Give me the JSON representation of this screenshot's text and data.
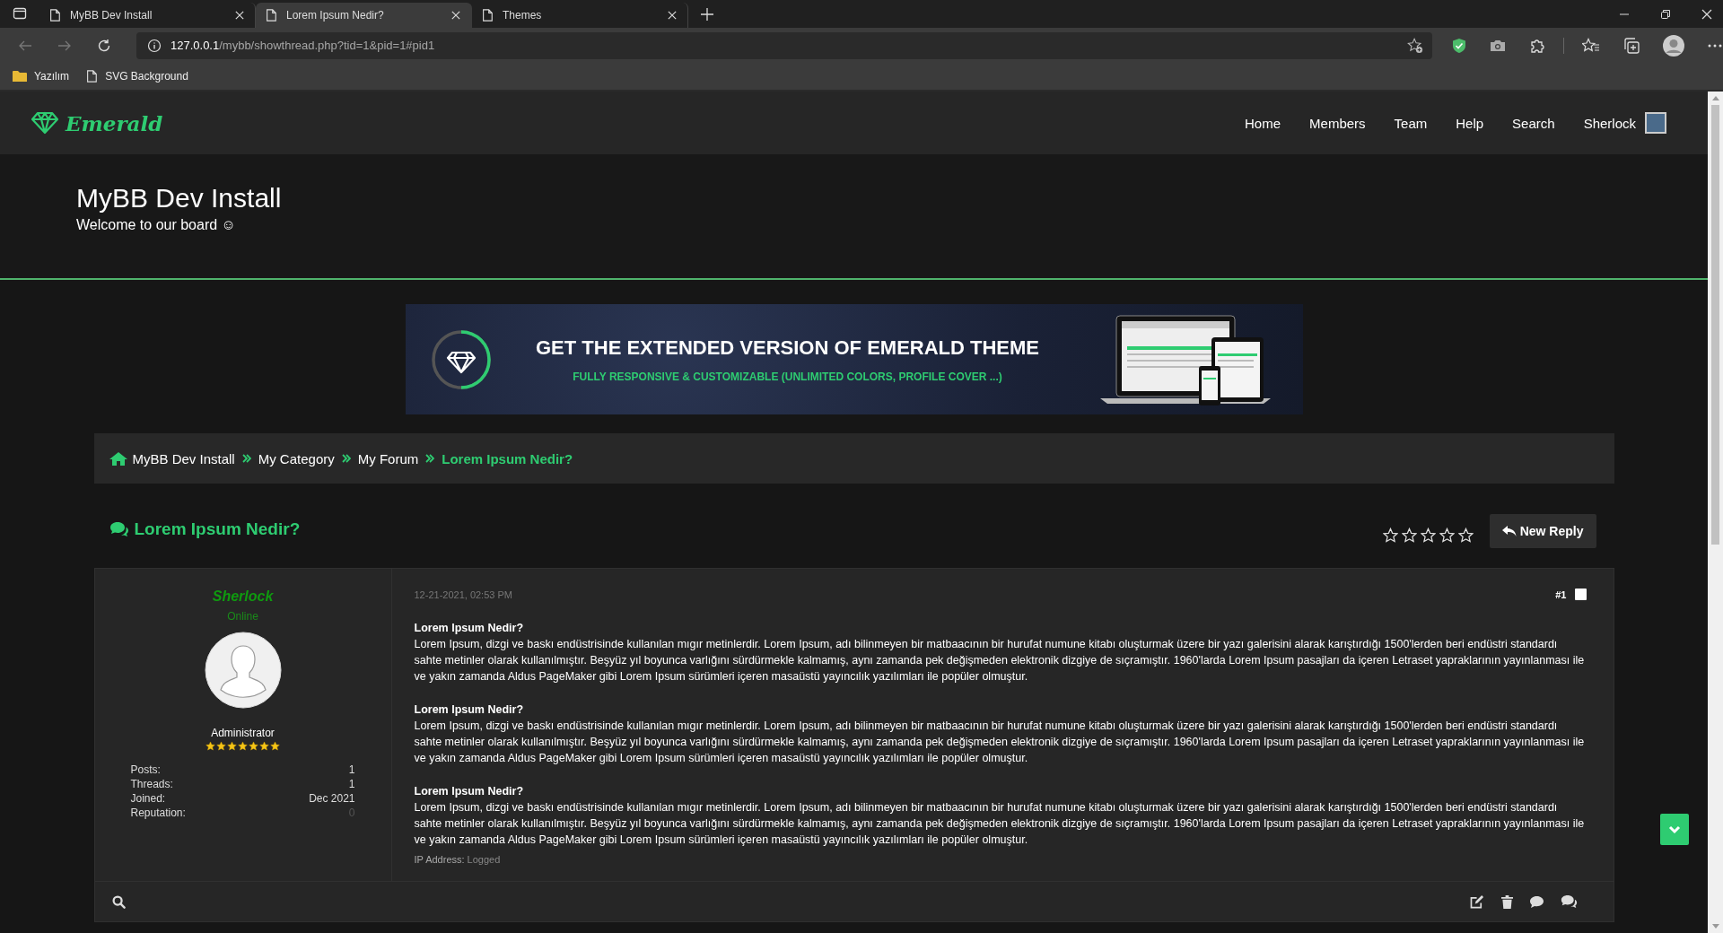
{
  "browser": {
    "tabs": [
      {
        "title": "MyBB Dev Install",
        "selected": false
      },
      {
        "title": "Lorem Ipsum Nedir?",
        "selected": true
      },
      {
        "title": "Themes",
        "selected": false
      }
    ],
    "address": {
      "host": "127.0.0.1",
      "path": "/mybb/showthread.php?tid=1&pid=1#pid1"
    },
    "bookmarks": [
      {
        "kind": "folder",
        "label": "Yazılım"
      },
      {
        "kind": "page",
        "label": "SVG Background"
      }
    ]
  },
  "site": {
    "logo": "Emerald",
    "nav": [
      "Home",
      "Members",
      "Team",
      "Help",
      "Search"
    ],
    "user": "Sherlock",
    "board_title": "MyBB Dev Install",
    "board_subtitle": "Welcome to our board ☺"
  },
  "banner": {
    "headline": "GET THE EXTENDED VERSION OF EMERALD THEME",
    "tagline": "FULLY RESPONSIVE & CUSTOMIZABLE (UNLIMITED COLORS, PROFILE COVER ...)"
  },
  "breadcrumb": [
    {
      "label": "MyBB Dev Install",
      "current": false
    },
    {
      "label": "My Category",
      "current": false
    },
    {
      "label": "My Forum",
      "current": false
    },
    {
      "label": "Lorem Ipsum Nedir?",
      "current": true
    }
  ],
  "thread": {
    "title": "Lorem Ipsum Nedir?",
    "rating": {
      "stars": 0
    },
    "new_reply": "New Reply"
  },
  "post": {
    "author": "Sherlock",
    "status": "Online",
    "role": "Administrator",
    "stars": 7,
    "stats": [
      {
        "label": "Posts:",
        "value": "1",
        "dim": false
      },
      {
        "label": "Threads:",
        "value": "1",
        "dim": false
      },
      {
        "label": "Joined:",
        "value": "Dec 2021",
        "dim": false
      },
      {
        "label": "Reputation:",
        "value": "0",
        "dim": true
      }
    ],
    "date": "12-21-2021, 02:53 PM",
    "number": "#1",
    "checked": false,
    "paragraphs": [
      {
        "heading": "Lorem Ipsum Nedir?",
        "text": "Lorem Ipsum, dizgi ve baskı endüstrisinde kullanılan mıgır metinlerdir. Lorem Ipsum, adı bilinmeyen bir matbaacının bir hurufat numune kitabı oluşturmak üzere bir yazı galerisini alarak karıştırdığı 1500'lerden beri endüstri standardı sahte metinler olarak kullanılmıştır. Beşyüz yıl boyunca varlığını sürdürmekle kalmamış, aynı zamanda pek değişmeden elektronik dizgiye de sıçramıştır. 1960'larda Lorem Ipsum pasajları da içeren Letraset yapraklarının yayınlanması ile ve yakın zamanda Aldus PageMaker gibi Lorem Ipsum sürümleri içeren masaüstü yayıncılık yazılımları ile popüler olmuştur."
      },
      {
        "heading": "Lorem Ipsum Nedir?",
        "text": "Lorem Ipsum, dizgi ve baskı endüstrisinde kullanılan mıgır metinlerdir. Lorem Ipsum, adı bilinmeyen bir matbaacının bir hurufat numune kitabı oluşturmak üzere bir yazı galerisini alarak karıştırdığı 1500'lerden beri endüstri standardı sahte metinler olarak kullanılmıştır. Beşyüz yıl boyunca varlığını sürdürmekle kalmamış, aynı zamanda pek değişmeden elektronik dizgiye de sıçramıştır. 1960'larda Lorem Ipsum pasajları da içeren Letraset yapraklarının yayınlanması ile ve yakın zamanda Aldus PageMaker gibi Lorem Ipsum sürümleri içeren masaüstü yayıncılık yazılımları ile popüler olmuştur."
      },
      {
        "heading": "Lorem Ipsum Nedir?",
        "text": "Lorem Ipsum, dizgi ve baskı endüstrisinde kullanılan mıgır metinlerdir. Lorem Ipsum, adı bilinmeyen bir matbaacının bir hurufat numune kitabı oluşturmak üzere bir yazı galerisini alarak karıştırdığı 1500'lerden beri endüstri standardı sahte metinler olarak kullanılmıştır. Beşyüz yıl boyunca varlığını sürdürmekle kalmamış, aynı zamanda pek değişmeden elektronik dizgiye de sıçramıştır. 1960'larda Lorem Ipsum pasajları da içeren Letraset yapraklarının yayınlanması ile ve yakın zamanda Aldus PageMaker gibi Lorem Ipsum sürümleri içeren masaüstü yayıncılık yazılımları ile popüler olmuştur."
      }
    ],
    "ip_label": "IP Address:",
    "ip_value": "Logged"
  }
}
